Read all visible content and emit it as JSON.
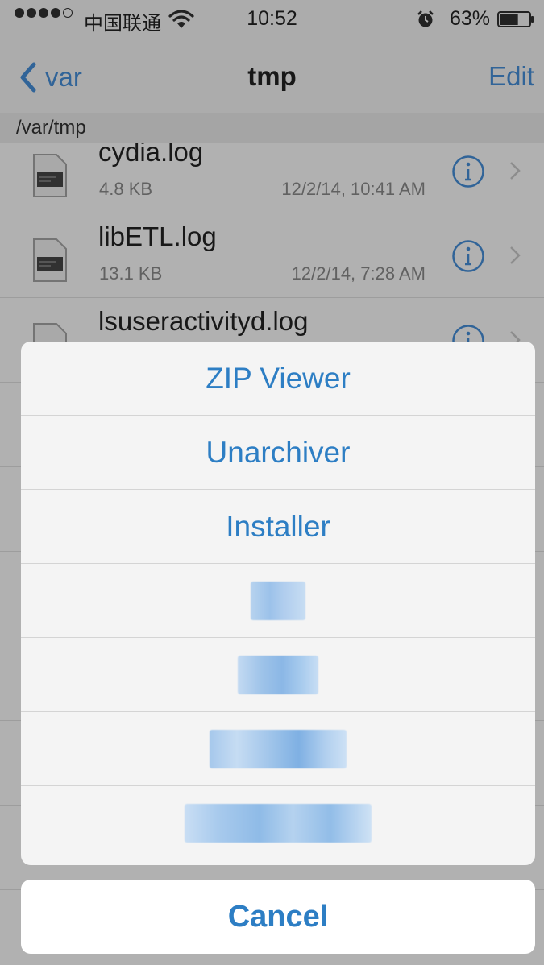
{
  "status_bar": {
    "carrier": "中国联通",
    "time": "10:52",
    "battery_percent": "63%",
    "battery_level": 0.63,
    "icons": [
      "signal-dots-icon",
      "wifi-icon",
      "alarm-icon",
      "battery-icon"
    ]
  },
  "nav": {
    "back_label": "var",
    "title": "tmp",
    "edit_label": "Edit"
  },
  "path": "/var/tmp",
  "files": [
    {
      "name": "cydia.log",
      "size": "4.8 KB",
      "date": "12/2/14, 10:41 AM"
    },
    {
      "name": "libETL.log",
      "size": "13.1 KB",
      "date": "12/2/14, 7:28 AM"
    },
    {
      "name": "lsuseractivityd.log",
      "size": "",
      "date": ""
    }
  ],
  "action_sheet": {
    "options": [
      "ZIP Viewer",
      "Unarchiver",
      "Installer"
    ],
    "cancel_label": "Cancel"
  },
  "colors": {
    "accent": "#2a7fd6",
    "sheet_text": "#2d7ec4",
    "blurred_text": "#a9c9ea"
  }
}
